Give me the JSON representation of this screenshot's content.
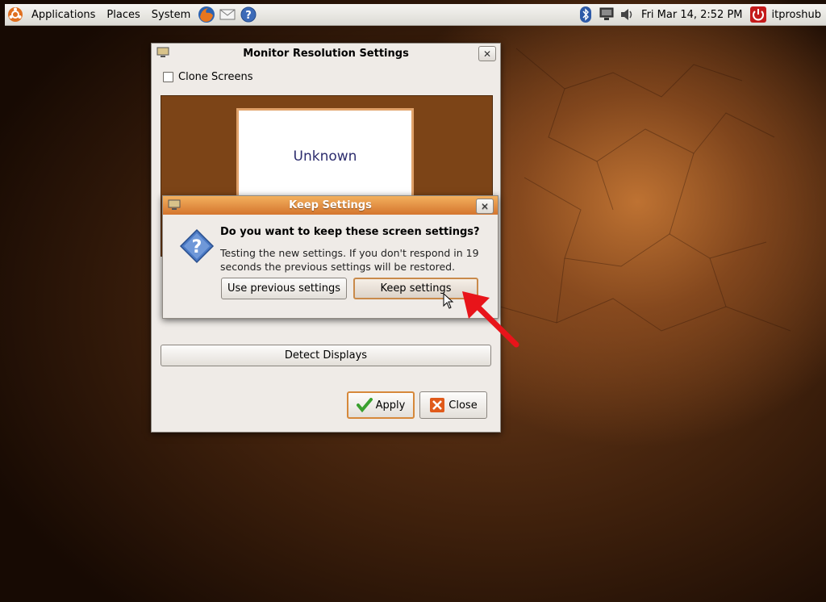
{
  "panel": {
    "menus": [
      "Applications",
      "Places",
      "System"
    ],
    "clock": "Fri Mar 14,  2:52 PM",
    "user": "itproshub"
  },
  "main_window": {
    "title": "Monitor Resolution Settings",
    "close_glyph": "✕",
    "clone_label": "Clone Screens",
    "monitor_label": "Unknown",
    "detect_label": "Detect Displays",
    "apply_label": "Apply",
    "close_label": "Close"
  },
  "keep_dialog": {
    "title": "Keep Settings",
    "close_glyph": "✕",
    "heading": "Do you want to keep these screen settings?",
    "body": "Testing the new settings. If you don't respond in 19 seconds the previous settings will be restored.",
    "use_previous_label": "Use previous settings",
    "keep_label": "Keep settings"
  },
  "colors": {
    "dialog_titlebar": "#d97f35",
    "default_button_border": "#d6883a",
    "annotation_arrow": "#e8141a"
  }
}
